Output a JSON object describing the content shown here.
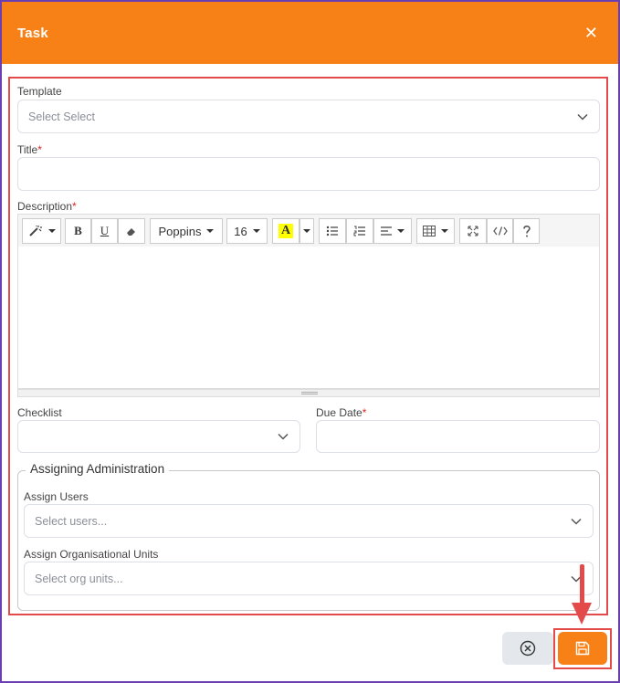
{
  "dialog": {
    "title": "Task",
    "close_glyph": "✕"
  },
  "form": {
    "template": {
      "label": "Template",
      "placeholder": "Select Select"
    },
    "title": {
      "label": "Title",
      "required_mark": "*"
    },
    "description": {
      "label": "Description",
      "required_mark": "*"
    },
    "toolbar": {
      "font_name": "Poppins",
      "font_size": "16",
      "highlight_letter": "A",
      "highlight_color": "#ffff00"
    },
    "checklist": {
      "label": "Checklist"
    },
    "due_date": {
      "label": "Due Date",
      "required_mark": "*"
    },
    "assigning": {
      "legend": "Assigning Administration",
      "users": {
        "label": "Assign Users",
        "placeholder": "Select users..."
      },
      "org_units": {
        "label": "Assign Organisational Units",
        "placeholder": "Select org units..."
      }
    }
  },
  "colors": {
    "accent": "#f78117",
    "highlight": "#e34b4b",
    "frame": "#6b3fb2"
  }
}
